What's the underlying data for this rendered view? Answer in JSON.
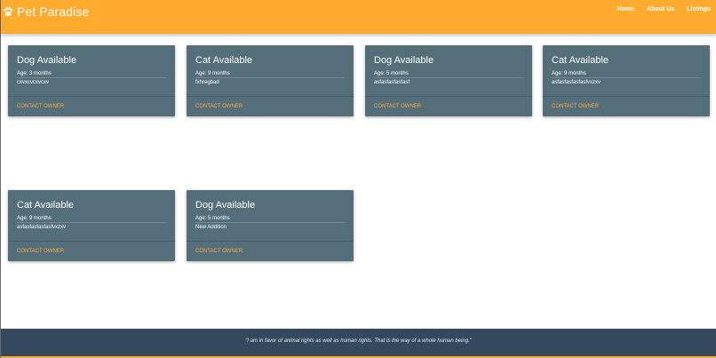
{
  "brand": {
    "title": "Pet Paradise",
    "icon": "paw-icon"
  },
  "nav": [
    {
      "label": "Home"
    },
    {
      "label": "About Us"
    },
    {
      "label": "Listings"
    }
  ],
  "cards": [
    {
      "title": "Dog Available",
      "age": "Age: 3 months",
      "desc": "cxvxcvcxvcxv",
      "action": "CONTACT OWNER"
    },
    {
      "title": "Cat Available",
      "age": "Age: 9 months",
      "desc": "fxhregbad",
      "action": "CONTACT OWNER"
    },
    {
      "title": "Dog Available",
      "age": "Age: 5 months",
      "desc": "asfasfasfasfasf",
      "action": "CONTACT OWNER"
    },
    {
      "title": "Cat Available",
      "age": "Age: 9 months",
      "desc": "asfasfasfasfasfvxzxv",
      "action": "CONTACT OWNER"
    },
    {
      "title": "Cat Available",
      "age": "Age: 9 months",
      "desc": "asfasfasfasfasfvxzxv",
      "action": "CONTACT OWNER"
    },
    {
      "title": "Dog Available",
      "age": "Age: 5 months",
      "desc": "New Addition",
      "action": "CONTACT OWNER"
    }
  ],
  "footer": {
    "quote": "\"I am in favor of animal rights as well as human rights. That is the way of a whole human being.\""
  },
  "colors": {
    "navbar": "#ffab2e",
    "card": "#546e7a",
    "action": "#ffab40",
    "footer": "#34495e"
  }
}
